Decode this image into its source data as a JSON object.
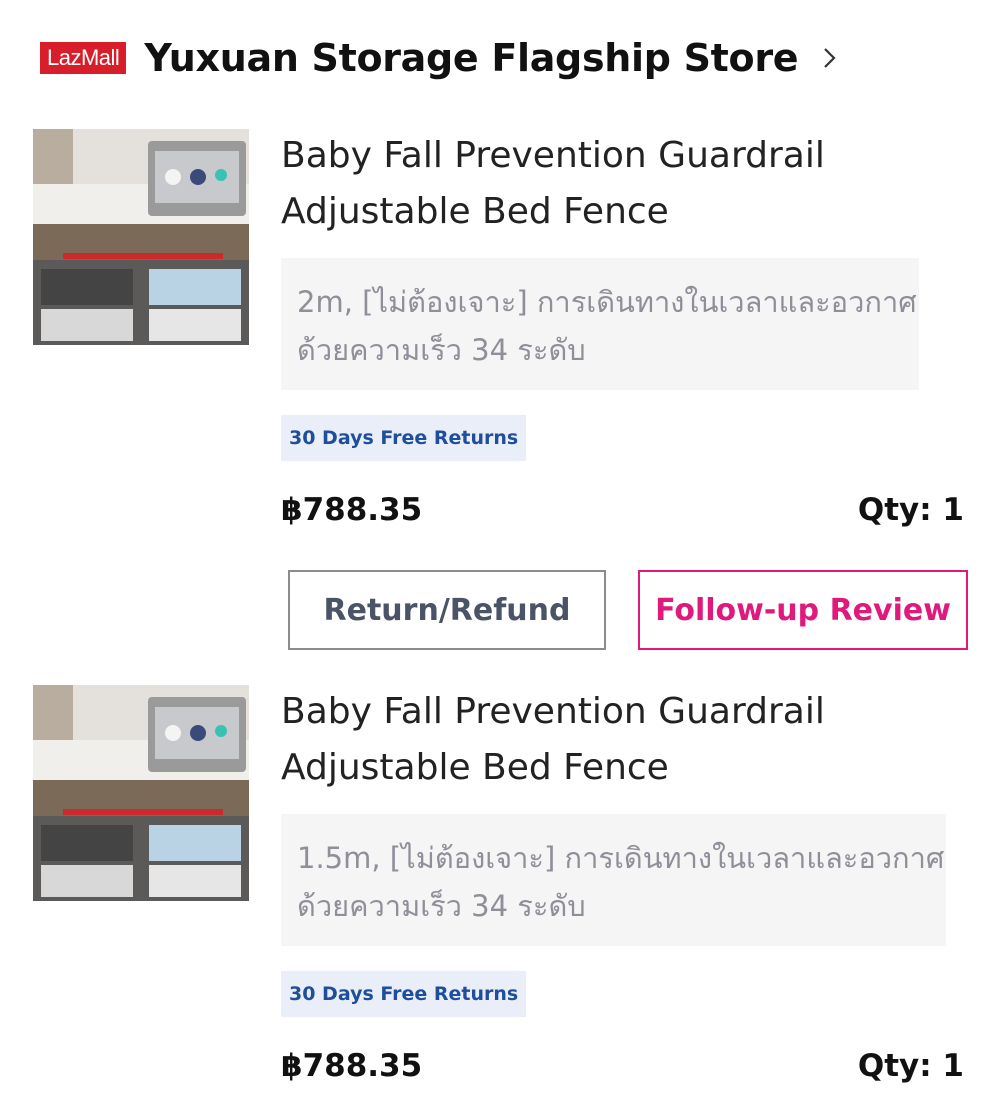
{
  "store": {
    "badge": "LazMall",
    "name": "Yuxuan Storage Flagship Store",
    "chevron_icon": "chevron-right-icon"
  },
  "items": [
    {
      "title_line1": "Baby Fall Prevention Guardrail",
      "title_line2": "Adjustable Bed Fence",
      "variant_line1": "2m, [ไม่ต้องเจาะ] การเดินทางในเวลาและอวกาศ",
      "variant_line2": "ด้วยความเร็ว 34 ระดับ",
      "returns_tag": "30 Days Free Returns",
      "price": "฿788.35",
      "qty_label": "Qty:",
      "qty_value": "1",
      "buttons": {
        "refund": "Return/Refund",
        "review": "Follow-up Review"
      }
    },
    {
      "title_line1": "Baby Fall Prevention Guardrail",
      "title_line2": "Adjustable Bed Fence",
      "variant_line1": "1.5m, [ไม่ต้องเจาะ] การเดินทางในเวลาและอวกาศ",
      "variant_line2": "ด้วยความเร็ว 34 ระดับ",
      "returns_tag": "30 Days Free Returns",
      "price": "฿788.35",
      "qty_label": "Qty:",
      "qty_value": "1"
    }
  ],
  "colors": {
    "lazmall_red": "#d81e2a",
    "review_pink": "#e0197d",
    "returns_blue": "#1f4f9c",
    "returns_bg": "#e9eef8"
  }
}
